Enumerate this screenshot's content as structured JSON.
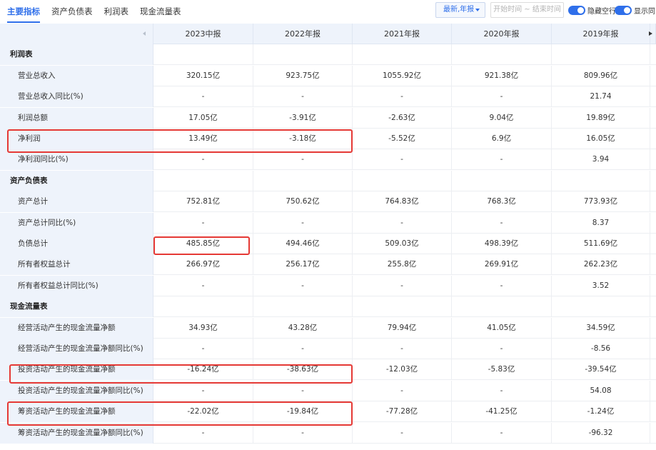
{
  "toolbar": {
    "tabs": [
      {
        "label": "主要指标",
        "active": true
      },
      {
        "label": "资产负债表",
        "active": false
      },
      {
        "label": "利润表",
        "active": false
      },
      {
        "label": "现金流量表",
        "active": false
      }
    ],
    "period_select": "最新,年报",
    "date_range_placeholder": "开始时间 ~ 结束时间",
    "toggle_hide_empty": {
      "label": "隐藏空行",
      "on": true
    },
    "toggle_show_yoy": {
      "label": "显示同比",
      "on": true
    }
  },
  "table": {
    "columns": [
      "2023中报",
      "2022年报",
      "2021年报",
      "2020年报",
      "2019年报"
    ],
    "rows": [
      {
        "type": "section",
        "label": "利润表"
      },
      {
        "type": "data",
        "label": "营业总收入",
        "values": [
          "320.15亿",
          "923.75亿",
          "1055.92亿",
          "921.38亿",
          "809.96亿"
        ]
      },
      {
        "type": "data",
        "label": "营业总收入同比(%)",
        "values": [
          "-",
          "-",
          "-",
          "-",
          "21.74"
        ]
      },
      {
        "type": "data",
        "label": "利润总额",
        "values": [
          "17.05亿",
          "-3.91亿",
          "-2.63亿",
          "9.04亿",
          "19.89亿"
        ]
      },
      {
        "type": "data",
        "label": "净利润",
        "values": [
          "13.49亿",
          "-3.18亿",
          "-5.52亿",
          "6.9亿",
          "16.05亿"
        ]
      },
      {
        "type": "data",
        "label": "净利润同比(%)",
        "values": [
          "-",
          "-",
          "-",
          "-",
          "3.94"
        ]
      },
      {
        "type": "section",
        "label": "资产负债表"
      },
      {
        "type": "data",
        "label": "资产总计",
        "values": [
          "752.81亿",
          "750.62亿",
          "764.83亿",
          "768.3亿",
          "773.93亿"
        ]
      },
      {
        "type": "data",
        "label": "资产总计同比(%)",
        "values": [
          "-",
          "-",
          "-",
          "-",
          "8.37"
        ]
      },
      {
        "type": "data",
        "label": "负债总计",
        "values": [
          "485.85亿",
          "494.46亿",
          "509.03亿",
          "498.39亿",
          "511.69亿"
        ]
      },
      {
        "type": "data",
        "label": "所有者权益总计",
        "values": [
          "266.97亿",
          "256.17亿",
          "255.8亿",
          "269.91亿",
          "262.23亿"
        ]
      },
      {
        "type": "data",
        "label": "所有者权益总计同比(%)",
        "values": [
          "-",
          "-",
          "-",
          "-",
          "3.52"
        ]
      },
      {
        "type": "section",
        "label": "现金流量表"
      },
      {
        "type": "data",
        "label": "经营活动产生的现金流量净额",
        "values": [
          "34.93亿",
          "43.28亿",
          "79.94亿",
          "41.05亿",
          "34.59亿"
        ]
      },
      {
        "type": "data",
        "label": "经营活动产生的现金流量净额同比(%)",
        "values": [
          "-",
          "-",
          "-",
          "-",
          "-8.56"
        ]
      },
      {
        "type": "data",
        "label": "投资活动产生的现金流量净额",
        "values": [
          "-16.24亿",
          "-38.63亿",
          "-12.03亿",
          "-5.83亿",
          "-39.54亿"
        ]
      },
      {
        "type": "data",
        "label": "投资活动产生的现金流量净额同比(%)",
        "values": [
          "-",
          "-",
          "-",
          "-",
          "54.08"
        ]
      },
      {
        "type": "data",
        "label": "筹资活动产生的现金流量净额",
        "values": [
          "-22.02亿",
          "-19.84亿",
          "-77.28亿",
          "-41.25亿",
          "-1.24亿"
        ]
      },
      {
        "type": "data",
        "label": "筹资活动产生的现金流量净额同比(%)",
        "values": [
          "-",
          "-",
          "-",
          "-",
          "-96.32"
        ]
      }
    ]
  },
  "colors": {
    "accent": "#2f6fea",
    "highlight": "#e53935",
    "label_column_bg": "#eef3fb"
  }
}
